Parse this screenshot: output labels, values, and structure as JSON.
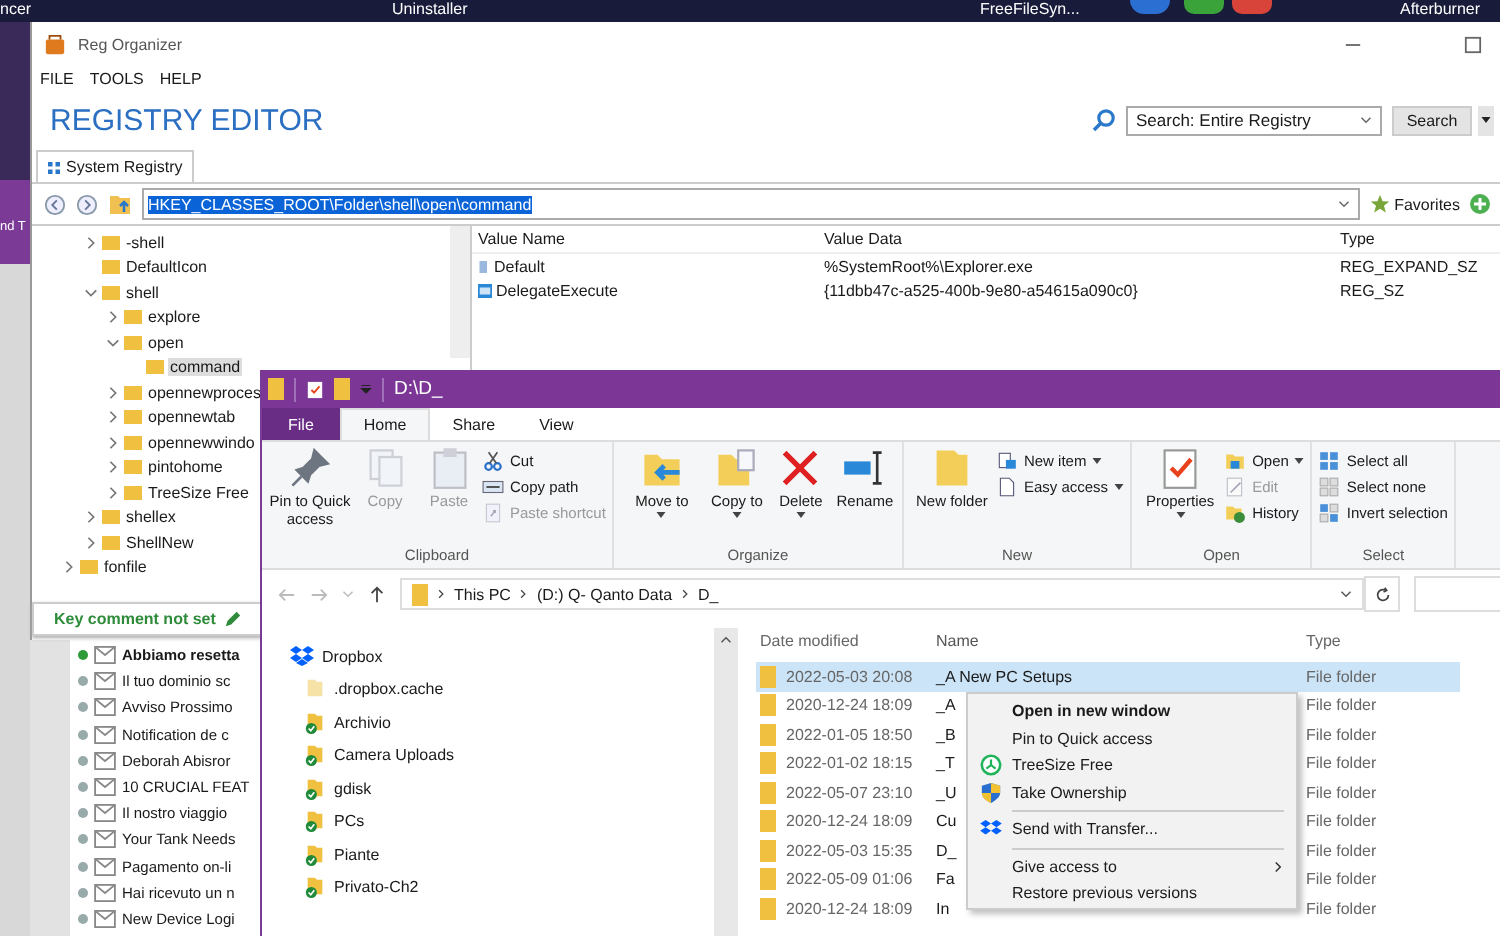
{
  "taskbar": {
    "items": [
      "ncer",
      "Uninstaller",
      "FreeFileSyn...",
      "Afterburner"
    ]
  },
  "background_window": {
    "text": "nd T"
  },
  "reg_organizer": {
    "title": "Reg Organizer",
    "menu": [
      "FILE",
      "TOOLS",
      "HELP"
    ],
    "heading": "REGISTRY EDITOR",
    "search": {
      "value": "Search: Entire Registry",
      "button": "Search"
    },
    "tabs": [
      {
        "label": "System Registry",
        "selected": true
      }
    ],
    "address": "HKEY_CLASSES_ROOT\\Folder\\shell\\open\\command",
    "favorites": "Favorites",
    "tree": {
      "nodes": [
        {
          "label": "-shell",
          "expanded": false,
          "selected": false
        },
        {
          "label": "DefaultIcon",
          "selected": false
        },
        {
          "label": "shell",
          "expanded": true,
          "selected": false,
          "children": [
            {
              "label": "explore",
              "expanded": false,
              "selected": false
            },
            {
              "label": "open",
              "expanded": true,
              "selected": false,
              "children": [
                {
                  "label": "command",
                  "selected": true
                }
              ]
            },
            {
              "label": "opennewproces",
              "expanded": false,
              "selected": false
            },
            {
              "label": "opennewtab",
              "expanded": false,
              "selected": false
            },
            {
              "label": "opennewwindo",
              "expanded": false,
              "selected": false
            },
            {
              "label": "pintohome",
              "expanded": false,
              "selected": false
            },
            {
              "label": "TreeSize Free",
              "expanded": false,
              "selected": false
            }
          ]
        },
        {
          "label": "shellex",
          "expanded": false,
          "selected": false
        },
        {
          "label": "ShellNew",
          "expanded": false,
          "selected": false
        }
      ],
      "next_nodes": [
        {
          "label": "fonfile",
          "expanded": false,
          "selected": false
        }
      ]
    },
    "values": {
      "columns": [
        "Value Name",
        "Value Data",
        "Type"
      ],
      "rows": [
        {
          "kind": "expand_string",
          "name": "Default",
          "data": "%SystemRoot%\\Explorer.exe",
          "type": "REG_EXPAND_SZ"
        },
        {
          "kind": "string",
          "name": "DelegateExecute",
          "data": "{11dbb47c-a525-400b-9e80-a54615a090c0}",
          "type": "REG_SZ"
        }
      ]
    },
    "key_comment": "Key comment not set"
  },
  "mail_list": [
    {
      "subject": "Abbiamo resetta",
      "unread": true
    },
    {
      "subject": "Il tuo dominio sc",
      "unread": false
    },
    {
      "subject": "Avviso Prossimo",
      "unread": false
    },
    {
      "subject": "Notification de c",
      "unread": false
    },
    {
      "subject": "Deborah Abisror",
      "unread": false
    },
    {
      "subject": "10 CRUCIAL FEAT",
      "unread": false
    },
    {
      "subject": "Il nostro viaggio",
      "unread": false
    },
    {
      "subject": "Your Tank Needs",
      "unread": false
    },
    {
      "subject": "Pagamento on-li",
      "unread": false
    },
    {
      "subject": "Hai ricevuto un n",
      "unread": false
    },
    {
      "subject": "New Device Logi",
      "unread": false
    }
  ],
  "explorer": {
    "title": "D:\\D_",
    "tabs": [
      {
        "label": "File",
        "kind": "file",
        "selected": false
      },
      {
        "label": "Home",
        "kind": "tab",
        "selected": true
      },
      {
        "label": "Share",
        "kind": "tab",
        "selected": false
      },
      {
        "label": "View",
        "kind": "tab",
        "selected": false
      }
    ],
    "ribbon": [
      {
        "label": "Clipboard",
        "buttons": [
          {
            "label": "Pin to Quick access",
            "kind": "large",
            "disabled": false,
            "dropdown": false
          },
          {
            "label": "Copy",
            "kind": "large",
            "disabled": true,
            "dropdown": false
          },
          {
            "label": "Paste",
            "kind": "large",
            "disabled": true,
            "dropdown": false
          },
          {
            "label": "Cut",
            "kind": "small",
            "disabled": false,
            "dropdown": false
          },
          {
            "label": "Copy path",
            "kind": "small",
            "disabled": false,
            "dropdown": false
          },
          {
            "label": "Paste shortcut",
            "kind": "small",
            "disabled": true,
            "dropdown": false
          }
        ]
      },
      {
        "label": "Organize",
        "buttons": [
          {
            "label": "Move to",
            "kind": "large",
            "disabled": false,
            "dropdown": true
          },
          {
            "label": "Copy to",
            "kind": "large",
            "disabled": false,
            "dropdown": true
          },
          {
            "label": "Delete",
            "kind": "large",
            "disabled": false,
            "dropdown": true
          },
          {
            "label": "Rename",
            "kind": "large",
            "disabled": false,
            "dropdown": false
          }
        ]
      },
      {
        "label": "New",
        "buttons": [
          {
            "label": "New folder",
            "kind": "large",
            "disabled": false,
            "dropdown": false
          },
          {
            "label": "New item",
            "kind": "small",
            "disabled": false,
            "dropdown": true
          },
          {
            "label": "Easy access",
            "kind": "small",
            "disabled": false,
            "dropdown": true
          }
        ]
      },
      {
        "label": "Open",
        "buttons": [
          {
            "label": "Properties",
            "kind": "large",
            "disabled": false,
            "dropdown": true
          },
          {
            "label": "Open",
            "kind": "small",
            "disabled": false,
            "dropdown": true
          },
          {
            "label": "Edit",
            "kind": "small",
            "disabled": true,
            "dropdown": false
          },
          {
            "label": "History",
            "kind": "small",
            "disabled": false,
            "dropdown": false
          }
        ]
      },
      {
        "label": "Select",
        "buttons": [
          {
            "label": "Select all",
            "kind": "small",
            "disabled": false,
            "dropdown": false
          },
          {
            "label": "Select none",
            "kind": "small",
            "disabled": false,
            "dropdown": false
          },
          {
            "label": "Invert selection",
            "kind": "small",
            "disabled": false,
            "dropdown": false
          }
        ]
      }
    ],
    "breadcrumb": [
      "This PC",
      "(D:) Q- Qanto Data",
      "D_"
    ],
    "nav": [
      {
        "label": "Dropbox",
        "kind": "root"
      },
      {
        "label": ".dropbox.cache",
        "kind": "folder",
        "synced": false
      },
      {
        "label": "Archivio",
        "kind": "folder",
        "synced": true
      },
      {
        "label": "Camera Uploads",
        "kind": "folder",
        "synced": true
      },
      {
        "label": "gdisk",
        "kind": "folder",
        "synced": true
      },
      {
        "label": "PCs",
        "kind": "folder",
        "synced": true
      },
      {
        "label": "Piante",
        "kind": "folder",
        "synced": true
      },
      {
        "label": "Privato-Ch2",
        "kind": "folder",
        "synced": true
      }
    ],
    "columns": [
      "Date modified",
      "Name",
      "Type"
    ],
    "files": [
      {
        "date": "2022-05-03 20:08",
        "name": "_A New PC Setups",
        "type": "File folder",
        "selected": true
      },
      {
        "date": "2020-12-24 18:09",
        "name": "_A",
        "type": "File folder",
        "selected": false
      },
      {
        "date": "2022-01-05 18:50",
        "name": "_B",
        "type": "File folder",
        "selected": false
      },
      {
        "date": "2022-01-02 18:15",
        "name": "_T",
        "type": "File folder",
        "selected": false
      },
      {
        "date": "2022-05-07 23:10",
        "name": "_U",
        "type": "File folder",
        "selected": false
      },
      {
        "date": "2020-12-24 18:09",
        "name": "Cu",
        "type": "File folder",
        "selected": false
      },
      {
        "date": "2022-05-03 15:35",
        "name": "D_",
        "type": "File folder",
        "selected": false
      },
      {
        "date": "2022-05-09 01:06",
        "name": "Fa",
        "type": "File folder",
        "selected": false
      },
      {
        "date": "2020-12-24 18:09",
        "name": "In",
        "type": "File folder",
        "selected": false
      }
    ],
    "context_menu": [
      {
        "kind": "item",
        "label": "Open in new window",
        "default": true,
        "submenu": false
      },
      {
        "kind": "item",
        "label": "Pin to Quick access",
        "default": false,
        "submenu": false
      },
      {
        "kind": "item",
        "label": "TreeSize Free",
        "default": false,
        "submenu": false
      },
      {
        "kind": "item",
        "label": "Take Ownership",
        "default": false,
        "submenu": false
      },
      {
        "kind": "separator"
      },
      {
        "kind": "item",
        "label": "Send with Transfer...",
        "default": false,
        "submenu": false
      },
      {
        "kind": "separator"
      },
      {
        "kind": "item",
        "label": "Give access to",
        "default": false,
        "submenu": true
      },
      {
        "kind": "item",
        "label": "Restore previous versions",
        "default": false,
        "submenu": false
      }
    ]
  }
}
